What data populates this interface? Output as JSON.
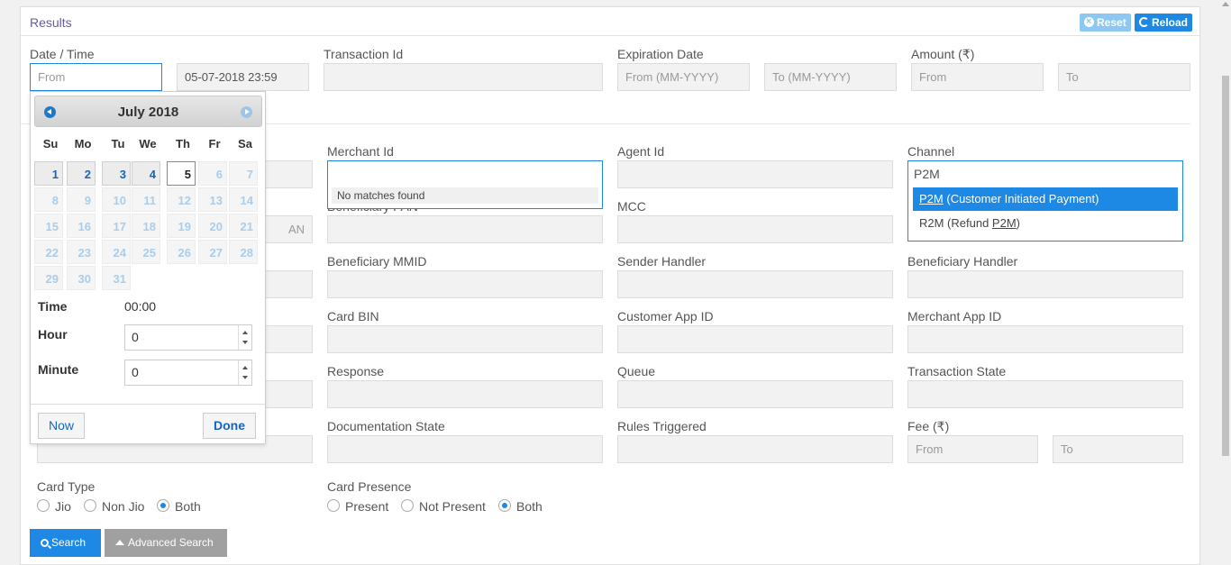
{
  "header": {
    "title": "Results",
    "reset_label": "Reset",
    "reload_label": "Reload"
  },
  "date_time": {
    "label": "Date / Time",
    "from_placeholder": "From",
    "to_value": "05-07-2018 23:59"
  },
  "transaction_id": {
    "label": "Transaction Id"
  },
  "expiration_date": {
    "label": "Expiration Date",
    "from_placeholder": "From (MM-YYYY)",
    "to_placeholder": "To (MM-YYYY)"
  },
  "amount": {
    "label": "Amount (₹)",
    "from_placeholder": "From",
    "to_placeholder": "To"
  },
  "merchant_id": {
    "label": "Merchant Id",
    "no_matches": "No matches found"
  },
  "agent_id": {
    "label": "Agent Id"
  },
  "channel": {
    "label": "Channel",
    "value": "P2M",
    "options": [
      {
        "code": "P2M",
        "desc": "(Customer Initiated Payment)"
      },
      {
        "prefix": "R2M (Refund ",
        "code": "P2M",
        "suffix": ")"
      }
    ]
  },
  "beneficiary_pan": {
    "label": "Beneficiary PAN"
  },
  "partial_placeholder": "AN",
  "mcc": {
    "label": "MCC"
  },
  "beneficiary_mmid": {
    "label": "Beneficiary MMID"
  },
  "sender_handler": {
    "label": "Sender Handler"
  },
  "beneficiary_handler": {
    "label": "Beneficiary Handler"
  },
  "card_bin": {
    "label": "Card BIN"
  },
  "customer_app_id": {
    "label": "Customer App ID"
  },
  "merchant_app_id": {
    "label": "Merchant App ID"
  },
  "response": {
    "label": "Response"
  },
  "queue": {
    "label": "Queue"
  },
  "transaction_state": {
    "label": "Transaction State"
  },
  "documentation_state": {
    "label": "Documentation State"
  },
  "rules_triggered": {
    "label": "Rules Triggered"
  },
  "fee": {
    "label": "Fee (₹)",
    "from_placeholder": "From",
    "to_placeholder": "To"
  },
  "card_type": {
    "label": "Card Type",
    "options": [
      "Jio",
      "Non Jio",
      "Both"
    ],
    "selected": "Both"
  },
  "card_presence": {
    "label": "Card Presence",
    "options": [
      "Present",
      "Not Present",
      "Both"
    ],
    "selected": "Both"
  },
  "buttons": {
    "search": "Search",
    "advanced_search": "Advanced Search"
  },
  "calendar": {
    "month_year": "July 2018",
    "weekdays": [
      "Su",
      "Mo",
      "Tu",
      "We",
      "Th",
      "Fr",
      "Sa"
    ],
    "days": [
      "1",
      "2",
      "3",
      "4",
      "5",
      "6",
      "7",
      "8",
      "9",
      "10",
      "11",
      "12",
      "13",
      "14",
      "15",
      "16",
      "17",
      "18",
      "19",
      "20",
      "21",
      "22",
      "23",
      "24",
      "25",
      "26",
      "27",
      "28",
      "29",
      "30",
      "31"
    ],
    "today": "5",
    "selectable_through": "5",
    "time_label": "Time",
    "time_value": "00:00",
    "hour_label": "Hour",
    "hour_value": "0",
    "minute_label": "Minute",
    "minute_value": "0",
    "now_label": "Now",
    "done_label": "Done"
  }
}
